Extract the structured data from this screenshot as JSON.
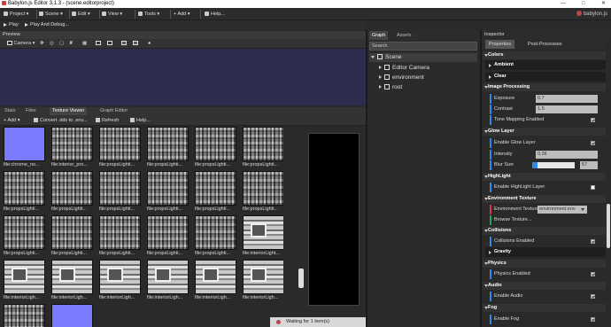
{
  "window": {
    "title": "Babylon.js Editor 3.1.3 - (scene.editorproject)"
  },
  "menu": {
    "items": [
      "Project",
      "Scene",
      "Edit",
      "View",
      "Tools",
      "Add",
      "Help..."
    ],
    "logo_text": "babylon.js"
  },
  "playbar": {
    "play": "Play",
    "play_debug": "Play And Debug..."
  },
  "preview": {
    "header": "Preview",
    "camera_label": "Camera",
    "canvas_color": "#2d2d52"
  },
  "bottom_tabs": {
    "tabs": [
      "Stats",
      "Files",
      "Texture Viewer",
      "Graph Editor"
    ],
    "active": "Texture Viewer"
  },
  "texture_toolbar": {
    "add": "Add",
    "convert": "Convert .dds to .env...",
    "refresh": "Refresh",
    "help": "Help..."
  },
  "textures": [
    [
      "file:chrome_no...",
      "file:interior_pro...",
      "file:propsLighti...",
      "file:propsLighti...",
      "file:propsLighti...",
      "file:propsLighti..."
    ],
    [
      "file:propsLighti...",
      "file:propsLighti...",
      "file:propsLighti...",
      "file:propsLighti...",
      "file:propsLighti...",
      "file:propsLighti..."
    ],
    [
      "file:propsLighti...",
      "file:propsLighti...",
      "file:propsLighti...",
      "file:propsLighti...",
      "file:propsLighti...",
      "file:interiorLight..."
    ],
    [
      "file:interiorLigh...",
      "file:interiorLigh...",
      "file:interiorLigh...",
      "file:interiorLigh...",
      "file:interiorLigh...",
      "file:interiorLigh..."
    ]
  ],
  "graph": {
    "tabs": [
      "Graph",
      "Assets"
    ],
    "search_placeholder": "Search",
    "scene": "Scene",
    "nodes": [
      "Editor Camera",
      "environment",
      "root"
    ]
  },
  "inspector": {
    "header": "Inspector",
    "tabs": [
      "Properties",
      "Post-Processes"
    ],
    "sections": {
      "colors": "Colors",
      "ambient": "Ambient",
      "clear": "Clear",
      "image_processing": "Image Processing",
      "exposure_label": "Exposure",
      "exposure_value": "0.7",
      "contrast_label": "Contrast",
      "contrast_value": "1.5",
      "tone_mapping": "Tone Mapping Enabled",
      "glow_layer": "Glow Layer",
      "enable_glow": "Enable Glow Layer",
      "intensity_label": "Intensity",
      "intensity_value": "0.36",
      "blur_label": "Blur Size",
      "blur_value": "57",
      "highlight": "HighLight",
      "enable_highlight": "Enable HighLight Layer",
      "env_texture": "Environment Texture",
      "env_texture_label": "Environment Texture",
      "env_texture_value": "environment.env",
      "browse": "Browse Texture...",
      "collisions": "Collisions",
      "collisions_enabled": "Collisions Enabled",
      "gravity": "Gravity",
      "physics": "Physics",
      "physics_enabled": "Physics Enabled",
      "audio": "Audio",
      "enable_audio": "Enable Audio",
      "fog": "Fog",
      "enable_fog": "Enable Fog"
    },
    "blur_fraction": 0.12
  },
  "status": {
    "text": "Waiting for 1 item(s)"
  }
}
